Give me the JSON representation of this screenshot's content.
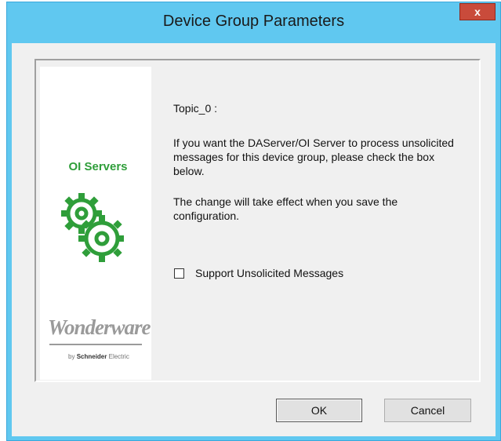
{
  "window": {
    "title": "Device Group Parameters",
    "close_label": "x"
  },
  "logo": {
    "product": "OI Servers",
    "brand": "Wonderware",
    "by_prefix": "by",
    "by_company": "Schneider",
    "by_suffix": "Electric"
  },
  "content": {
    "topic": "Topic_0 :",
    "message1": "If you want the DAServer/OI Server to process unsolicited messages for this device group, please check the box below.",
    "message2": "The change will take effect when you save the configuration."
  },
  "checkbox": {
    "label": "Support Unsolicited Messages",
    "checked": false
  },
  "buttons": {
    "ok": "OK",
    "cancel": "Cancel"
  },
  "colors": {
    "titlebar": "#60c8f0",
    "close": "#c94b3b",
    "brand_green": "#2f9e3a"
  }
}
